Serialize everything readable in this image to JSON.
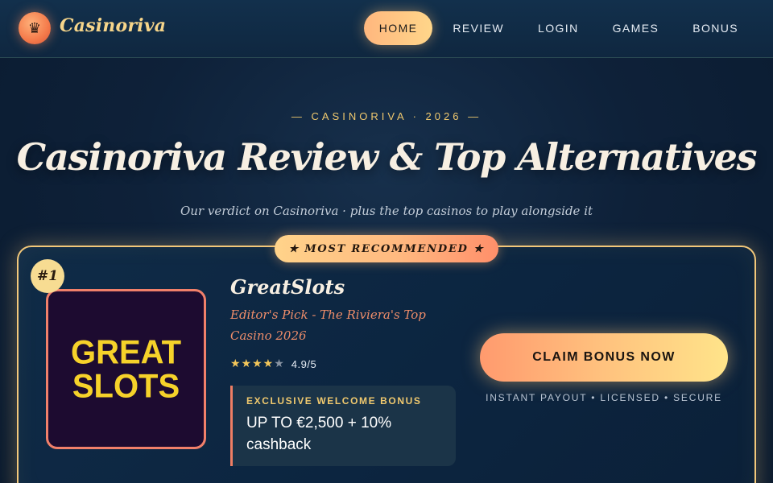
{
  "header": {
    "logo_glyph": "♛",
    "brand": "Casinoriva",
    "nav": [
      {
        "label": "HOME"
      },
      {
        "label": "REVIEW"
      },
      {
        "label": "LOGIN"
      },
      {
        "label": "GAMES"
      },
      {
        "label": "BONUS"
      }
    ]
  },
  "hero": {
    "kicker": "— CASINORIVA · 2026 —",
    "title": "Casinoriva Review & Top Alternatives",
    "subtitle": "Our verdict on Casinoriva · plus the top casinos to play alongside it"
  },
  "card": {
    "ribbon": "★ MOST RECOMMENDED ★",
    "rank": "#1",
    "logo_lines": [
      "GREAT",
      "SLOTS"
    ],
    "name": "GreatSlots",
    "tagline": "Editor's Pick - The Riviera's Top Casino 2026",
    "stars_on": "★★★★",
    "stars_off": "★",
    "rating": 4.9,
    "rating_text": "4.9/5",
    "bonus_label": "EXCLUSIVE WELCOME BONUS",
    "bonus_value": "UP TO €2,500 + 10% cashback",
    "cta": "CLAIM BONUS NOW",
    "trust": "INSTANT PAYOUT • LICENSED • SECURE"
  },
  "colors": {
    "accent_gold": "#f0c96e",
    "accent_coral": "#ef7e64",
    "background": "#0e2139"
  }
}
